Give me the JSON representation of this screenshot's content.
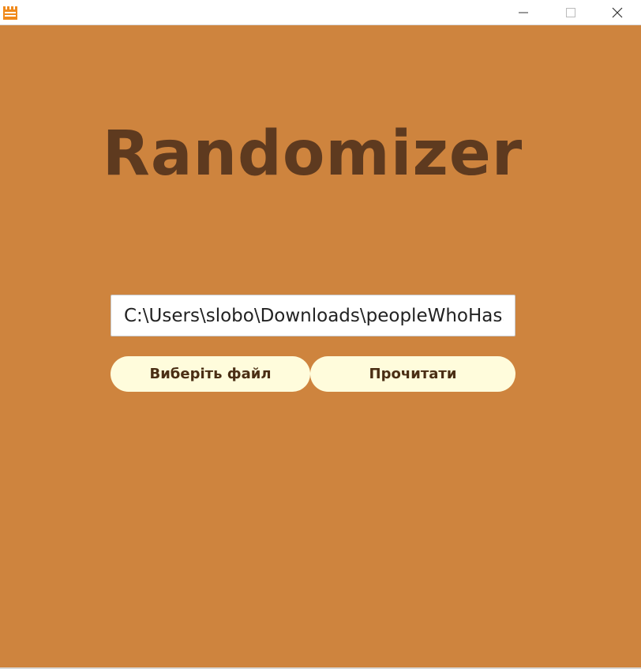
{
  "window": {
    "icon": "castle-app-icon",
    "controls": {
      "minimize_icon": "minimize-icon",
      "maximize_icon": "maximize-icon",
      "close_icon": "close-icon"
    }
  },
  "main": {
    "title": "Randomizer",
    "file_path_value": "C:\\Users\\slobo\\Downloads\\peopleWhoHasS",
    "choose_file_label": "Виберіть файл",
    "read_label": "Прочитати"
  },
  "colors": {
    "background": "#CE843E",
    "title": "#5E3A1F",
    "button_bg": "#FFFCDC",
    "button_text": "#4A2E14"
  }
}
